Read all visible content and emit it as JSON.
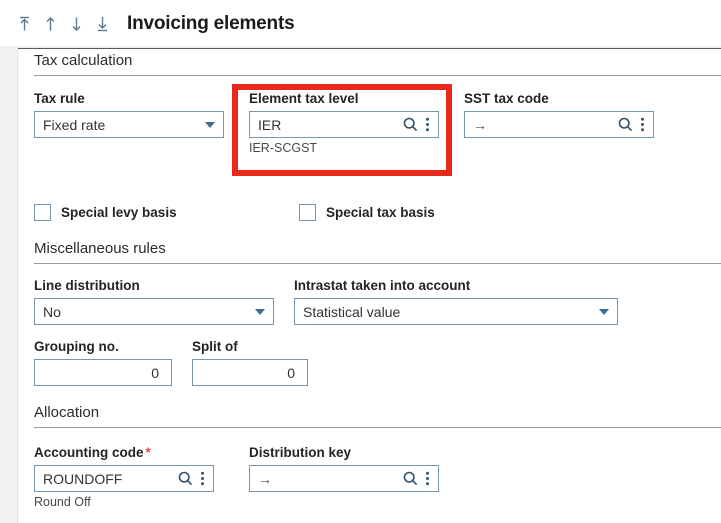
{
  "header": {
    "title": "Invoicing elements",
    "nav": [
      {
        "name": "first-record-icon",
        "label": "First record"
      },
      {
        "name": "previous-record-icon",
        "label": "Previous record"
      },
      {
        "name": "next-record-icon",
        "label": "Next record"
      },
      {
        "name": "last-record-icon",
        "label": "Last record"
      }
    ]
  },
  "sections": {
    "tax_calculation": "Tax calculation",
    "miscellaneous_rules": "Miscellaneous rules",
    "allocation": "Allocation"
  },
  "fields": {
    "tax_rule": {
      "label": "Tax rule",
      "value": "Fixed rate",
      "type": "dropdown"
    },
    "element_tax_level": {
      "label": "Element tax level",
      "value": "IER",
      "helper": "IER-SCGST",
      "type": "lookup"
    },
    "sst_tax_code": {
      "label": "SST tax code",
      "value": "→",
      "type": "lookup"
    },
    "special_levy_basis": {
      "label": "Special levy basis",
      "checked": false
    },
    "special_tax_basis": {
      "label": "Special tax basis",
      "checked": false
    },
    "line_distribution": {
      "label": "Line distribution",
      "value": "No",
      "type": "dropdown"
    },
    "intrastat_taken_into_account": {
      "label": "Intrastat taken into account",
      "value": "Statistical value",
      "type": "dropdown"
    },
    "grouping_no": {
      "label": "Grouping no.",
      "value": "0",
      "type": "number"
    },
    "split_of": {
      "label": "Split of",
      "value": "0",
      "type": "number"
    },
    "accounting_code": {
      "label": "Accounting code",
      "required_marker": "*",
      "value": "ROUNDOFF",
      "helper": "Round Off",
      "type": "lookup"
    },
    "distribution_key": {
      "label": "Distribution key",
      "value": "→",
      "type": "lookup"
    }
  },
  "icons": {
    "search": "search-icon",
    "menu": "vertical-ellipsis-icon",
    "caret": "chevron-down-icon"
  },
  "annotation": {
    "highlight_target": "element-tax-level-field",
    "color": "#e8291c"
  }
}
